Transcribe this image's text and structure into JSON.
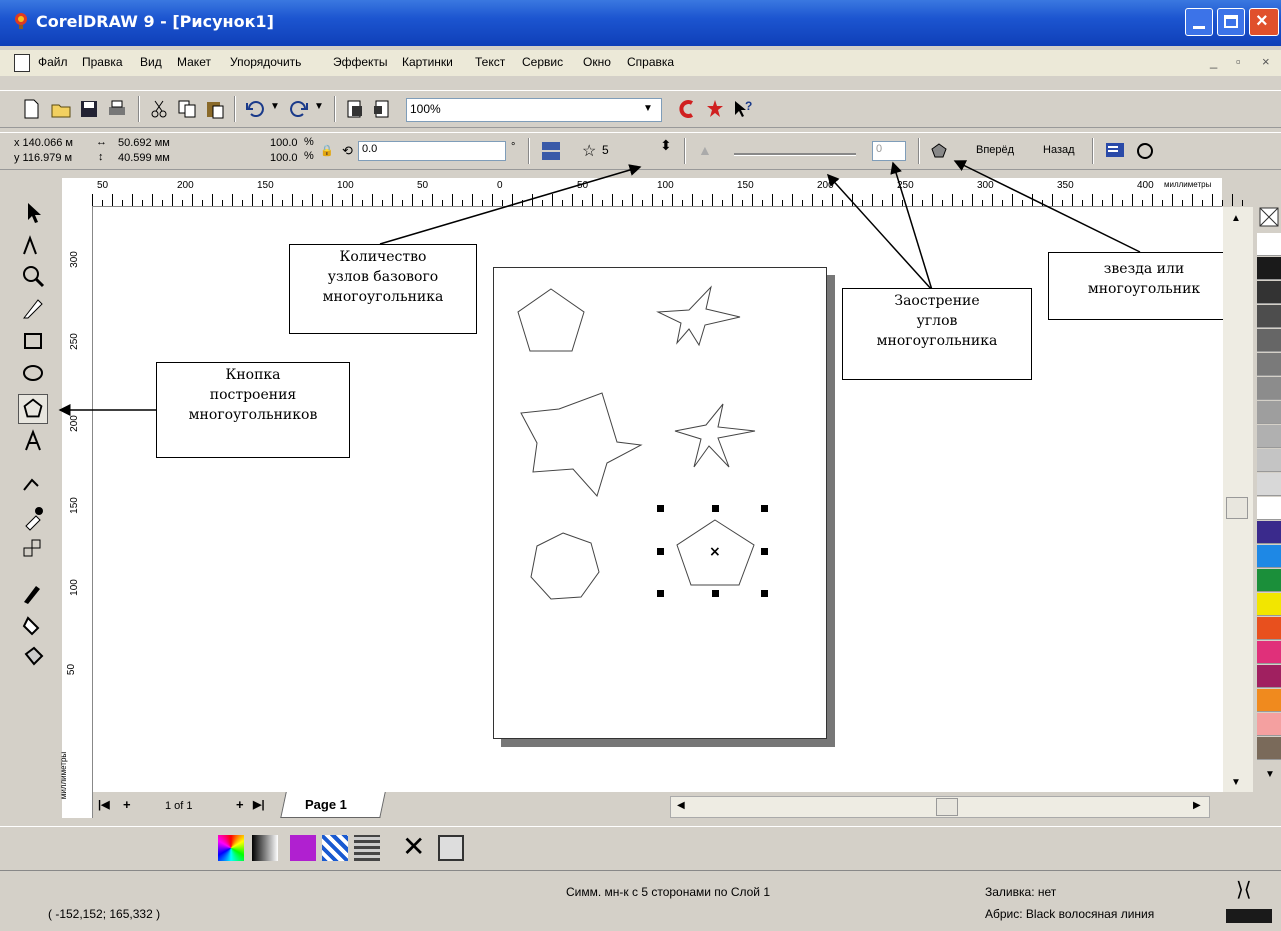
{
  "window": {
    "title": "CorelDRAW 9 - [Рисунок1]"
  },
  "menu": {
    "items": [
      "Файл",
      "Правка",
      "Вид",
      "Макет",
      "Упорядочить",
      "Эффекты",
      "Картинки",
      "Текст",
      "Сервис",
      "Окно",
      "Справка"
    ]
  },
  "toolbar": {
    "zoom": "100%"
  },
  "property_bar": {
    "x": "x 140.066 м",
    "y": "y 116.979 м",
    "width": "50.692 мм",
    "height": "40.599 мм",
    "scale_x": "100.0",
    "scale_y": "100.0",
    "scale_unit_x": "%",
    "scale_unit_y": "%",
    "angle": "0.0",
    "degree_symbol": "°",
    "points": "5",
    "sharpness": "0",
    "forward_label": "Вперёд",
    "back_label": "Назад"
  },
  "ruler": {
    "top_ticks": [
      "50",
      "200",
      "150",
      "100",
      "50",
      "0",
      "50",
      "100",
      "150",
      "200",
      "250",
      "300",
      "350",
      "400"
    ],
    "unit": "миллиметры",
    "left_ticks": [
      "300",
      "250",
      "200",
      "150",
      "100",
      "50"
    ],
    "left_unit": "миллиметры"
  },
  "page_nav": {
    "counter": "1 of 1",
    "tab": "Page 1"
  },
  "status": {
    "object_info": "Симм. мн-к с 5 сторонами по Слой 1",
    "fill": "Заливка: нет",
    "outline": "Абрис: Black  волосяная линия",
    "coords": "( -152,152; 165,332 )"
  },
  "callouts": {
    "nodes": [
      "Количество",
      "узлов базового",
      "многоугольника"
    ],
    "polygon_tool": [
      "Кнопка",
      "построения",
      "многоугольников"
    ],
    "sharpness": [
      "Заострение",
      "углов",
      "многоугольника"
    ],
    "star_or_polygon": [
      "звезда или",
      "многоугольник"
    ]
  },
  "palette": [
    "#ffffff",
    "#1a1a1a",
    "#333333",
    "#4d4d4d",
    "#666666",
    "#7a7a7a",
    "#8c8c8c",
    "#9e9e9e",
    "#b0b0b0",
    "#c4c4c4",
    "#d8d8d8",
    "#ffffff",
    "#3a2a8c",
    "#1e88e5",
    "#1b8f3a",
    "#f2e600",
    "#e8501e",
    "#e0307a",
    "#a02060",
    "#f08a1e",
    "#f4a0a0",
    "#7a6a5a"
  ]
}
